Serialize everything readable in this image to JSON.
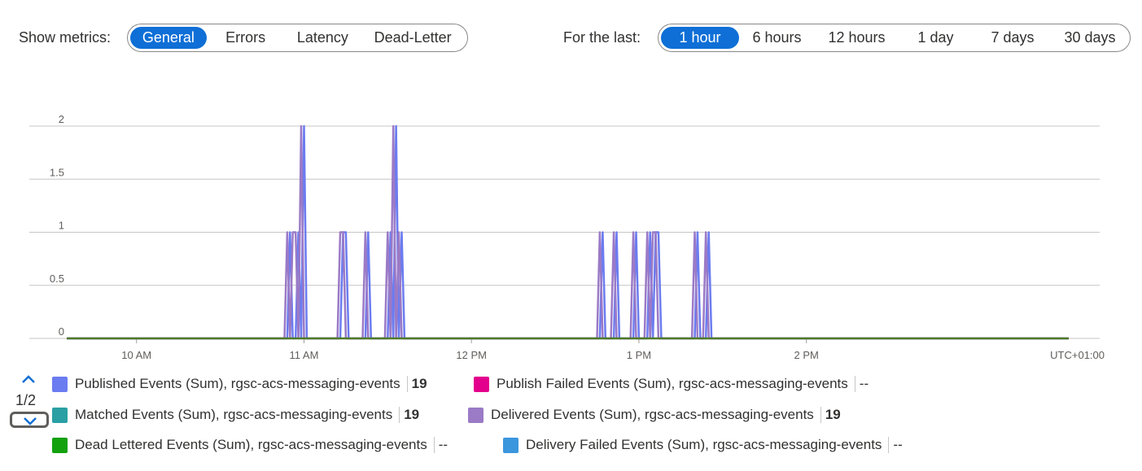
{
  "metrics": {
    "label": "Show metrics:",
    "options": [
      "General",
      "Errors",
      "Latency",
      "Dead-Letter"
    ],
    "selected": "General"
  },
  "time_range": {
    "label": "For the last:",
    "options": [
      "1 hour",
      "6 hours",
      "12 hours",
      "1 day",
      "7 days",
      "30 days"
    ],
    "selected": "6 hours"
  },
  "legend": {
    "pager": "1/2",
    "items": [
      {
        "label": "Published Events (Sum), rgsc-acs-messaging-events",
        "value": "19",
        "color": "#6b7cf0"
      },
      {
        "label": "Publish Failed Events (Sum), rgsc-acs-messaging-events",
        "value": "--",
        "color": "#e3008c"
      },
      {
        "label": "Matched Events (Sum), rgsc-acs-messaging-events",
        "value": "19",
        "color": "#2aa0a4"
      },
      {
        "label": "Delivered Events (Sum), rgsc-acs-messaging-events",
        "value": "19",
        "color": "#9b7ac6"
      },
      {
        "label": "Dead Lettered Events (Sum), rgsc-acs-messaging-events",
        "value": "--",
        "color": "#13a10e"
      },
      {
        "label": "Delivery Failed Events (Sum), rgsc-acs-messaging-events",
        "value": "--",
        "color": "#3a96dd"
      }
    ]
  },
  "chart_data": {
    "type": "line",
    "timezone_label": "UTC+01:00",
    "x_ticks": [
      "10 AM",
      "11 AM",
      "12 PM",
      "1 PM",
      "2 PM"
    ],
    "x_tick_minutes": [
      600,
      660,
      720,
      780,
      840
    ],
    "xlim_minutes": [
      575,
      934
    ],
    "ylim": [
      0,
      2
    ],
    "y_ticks": [
      0,
      0.5,
      1,
      1.5,
      2
    ],
    "y_tick_labels": [
      "0",
      "0.5",
      "1",
      "1.5",
      "2"
    ],
    "grid": true,
    "series": [
      {
        "name": "Published Events (Sum), rgsc-acs-messaging-events",
        "color": "#6b7cf0",
        "points": [
          [
            575,
            0
          ],
          [
            654,
            0
          ],
          [
            655,
            1
          ],
          [
            656,
            0
          ],
          [
            657,
            0
          ],
          [
            658,
            1
          ],
          [
            659,
            0
          ],
          [
            660,
            2
          ],
          [
            661,
            0
          ],
          [
            673,
            0
          ],
          [
            674,
            1
          ],
          [
            675,
            1
          ],
          [
            676,
            0
          ],
          [
            682,
            0
          ],
          [
            683,
            1
          ],
          [
            684,
            0
          ],
          [
            690,
            0
          ],
          [
            691,
            1
          ],
          [
            692,
            0
          ],
          [
            693,
            2
          ],
          [
            694,
            0
          ],
          [
            695,
            1
          ],
          [
            696,
            0
          ],
          [
            766,
            0
          ],
          [
            767,
            1
          ],
          [
            768,
            0
          ],
          [
            771,
            0
          ],
          [
            772,
            1
          ],
          [
            773,
            0
          ],
          [
            778,
            0
          ],
          [
            779,
            1
          ],
          [
            780,
            0
          ],
          [
            783,
            0
          ],
          [
            784,
            1
          ],
          [
            785,
            0
          ],
          [
            786,
            1
          ],
          [
            787,
            1
          ],
          [
            788,
            0
          ],
          [
            800,
            0
          ],
          [
            801,
            1
          ],
          [
            802,
            0
          ],
          [
            804,
            0
          ],
          [
            805,
            1
          ],
          [
            806,
            0
          ],
          [
            934,
            0
          ]
        ]
      },
      {
        "name": "Delivered Events (Sum), rgsc-acs-messaging-events",
        "color": "#9b7ac6",
        "points": [
          [
            575,
            0
          ],
          [
            653,
            0
          ],
          [
            654,
            1
          ],
          [
            655,
            0
          ],
          [
            656,
            1
          ],
          [
            657,
            1
          ],
          [
            658,
            0
          ],
          [
            659,
            2
          ],
          [
            660,
            0
          ],
          [
            672,
            0
          ],
          [
            673,
            1
          ],
          [
            674,
            1
          ],
          [
            675,
            0
          ],
          [
            681,
            0
          ],
          [
            682,
            1
          ],
          [
            683,
            0
          ],
          [
            689,
            0
          ],
          [
            690,
            1
          ],
          [
            691,
            0
          ],
          [
            692,
            2
          ],
          [
            693,
            0
          ],
          [
            694,
            1
          ],
          [
            695,
            0
          ],
          [
            765,
            0
          ],
          [
            766,
            1
          ],
          [
            767,
            0
          ],
          [
            770,
            0
          ],
          [
            771,
            1
          ],
          [
            772,
            0
          ],
          [
            777,
            0
          ],
          [
            778,
            1
          ],
          [
            779,
            0
          ],
          [
            782,
            0
          ],
          [
            783,
            1
          ],
          [
            784,
            0
          ],
          [
            785,
            1
          ],
          [
            786,
            1
          ],
          [
            787,
            0
          ],
          [
            799,
            0
          ],
          [
            800,
            1
          ],
          [
            801,
            0
          ],
          [
            803,
            0
          ],
          [
            804,
            1
          ],
          [
            805,
            0
          ],
          [
            934,
            0
          ]
        ]
      },
      {
        "name": "Dead Lettered Events (Sum), rgsc-acs-messaging-events",
        "color": "#4f7a28",
        "points": [
          [
            575,
            0
          ],
          [
            934,
            0
          ]
        ]
      }
    ]
  }
}
